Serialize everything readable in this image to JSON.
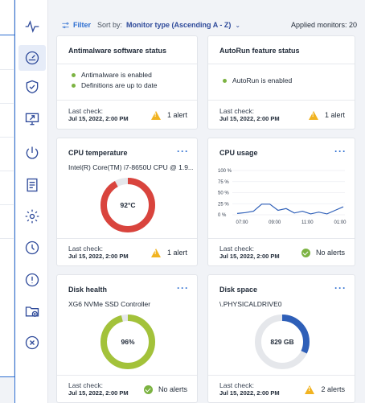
{
  "toolbar": {
    "filter_label": "Filter",
    "sort_label": "Sort by:",
    "sort_value": "Monitor type (Ascending A - Z)",
    "applied": "Applied monitors: 20"
  },
  "sidebar": {
    "icons": [
      "monitoring-icon",
      "dashboard-icon",
      "protection-icon",
      "remote-desktop-icon",
      "power-icon",
      "report-icon",
      "settings-icon",
      "history-icon",
      "alert-icon",
      "folder-add-icon",
      "close-circle-icon"
    ]
  },
  "cards": {
    "antimalware": {
      "title": "Antimalware software status",
      "items": [
        "Antimalware is enabled",
        "Definitions are up to date"
      ],
      "last_check": "Last check:",
      "date": "Jul 15, 2022, 2:00 PM",
      "status": "1 alert"
    },
    "autorun": {
      "title": "AutoRun feature status",
      "items": [
        "AutoRun is enabled"
      ],
      "last_check": "Last check:",
      "date": "Jul 15, 2022, 2:00 PM",
      "status": "1 alert"
    },
    "cpu_temp": {
      "title": "CPU temperature",
      "subtitle": "Intel(R) Core(TM) i7-8650U CPU @ 1.9...",
      "value": "92°C",
      "fill": 0.92,
      "color": "#d9443d",
      "last_check": "Last check:",
      "date": "Jul 15, 2022, 2:00 PM",
      "status": "1 alert"
    },
    "cpu_usage": {
      "title": "CPU usage",
      "last_check": "Last check:",
      "date": "Jul 15, 2022, 2:00 PM",
      "status": "No alerts"
    },
    "disk_health": {
      "title": "Disk health",
      "subtitle": "XG6 NVMe SSD Controller",
      "value": "96%",
      "fill": 0.96,
      "color": "#a3c23a",
      "last_check": "Last check:",
      "date": "Jul 15, 2022, 2:00 PM",
      "status": "No alerts"
    },
    "disk_space": {
      "title": "Disk space",
      "subtitle": "\\.PHYSICALDRIVE0",
      "value": "829 GB",
      "fill": 0.32,
      "color": "#2e5fb8",
      "last_check": "Last check:",
      "date": "Jul 15, 2022, 2:00 PM",
      "status": "2 alerts"
    }
  },
  "chart_data": {
    "type": "line",
    "x": [
      "07:00",
      "07:30",
      "08:00",
      "08:15",
      "08:30",
      "09:00",
      "09:30",
      "10:00",
      "10:30",
      "11:00",
      "11:30",
      "12:00",
      "12:30",
      "13:00"
    ],
    "values": [
      3,
      5,
      8,
      24,
      24,
      10,
      14,
      4,
      8,
      2,
      6,
      2,
      10,
      18
    ],
    "xticks": [
      "07:00",
      "09:00",
      "11:00",
      "01:00"
    ],
    "yticks": [
      "0 %",
      "25 %",
      "50 %",
      "75 %",
      "100 %"
    ],
    "ylim": [
      0,
      100
    ],
    "color": "#2e5fb8"
  }
}
